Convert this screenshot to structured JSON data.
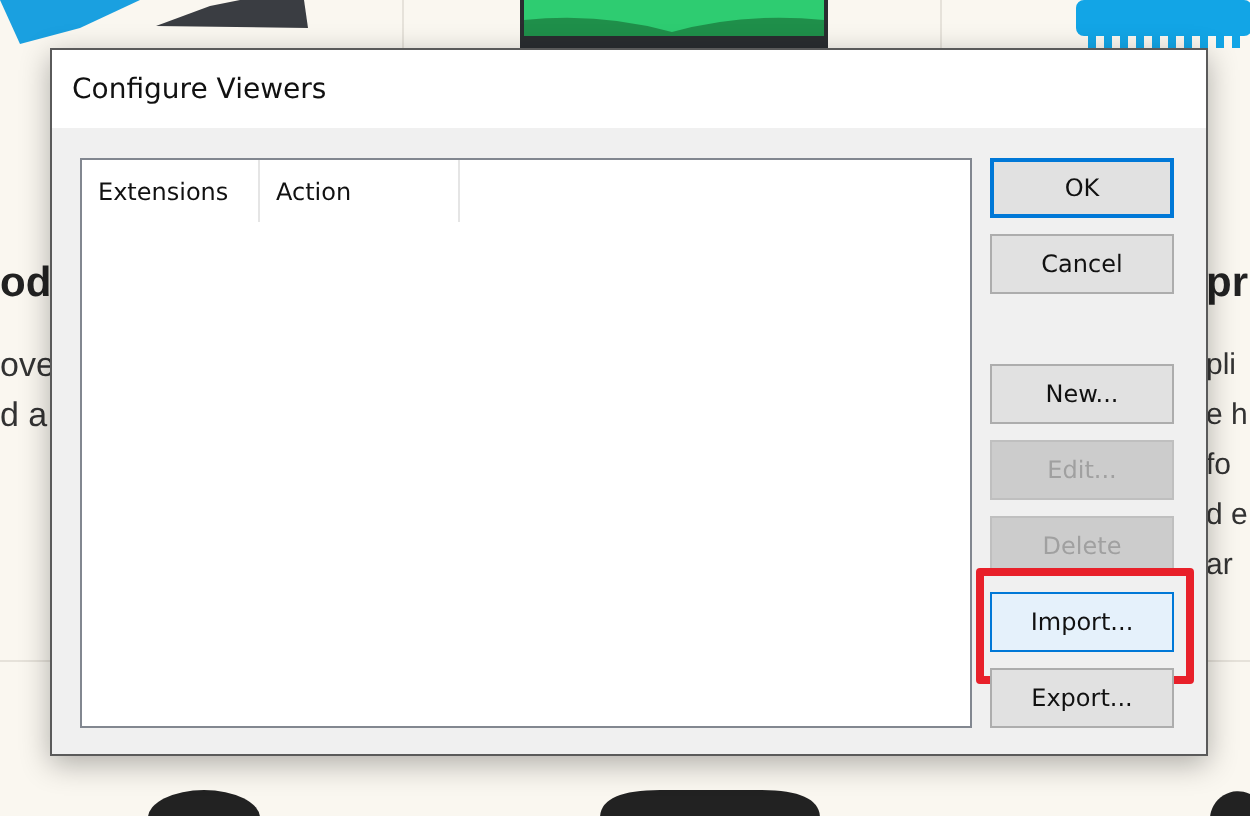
{
  "page": {
    "left_column": {
      "heading": "od",
      "lines": [
        "ove",
        "d a"
      ]
    },
    "right_column": {
      "heading": "pr",
      "lines": [
        "pli",
        "e h",
        "fo",
        "d e",
        "ar"
      ]
    }
  },
  "dialog": {
    "title": "Configure Viewers",
    "list": {
      "columns": [
        "Extensions",
        "Action"
      ]
    },
    "buttons": [
      {
        "label": "OK",
        "spaced": false,
        "default": true,
        "disabled": false,
        "highlighted": false,
        "annotated": false
      },
      {
        "label": "Cancel",
        "spaced": false,
        "default": false,
        "disabled": false,
        "highlighted": false,
        "annotated": false
      },
      {
        "label": "New...",
        "spaced": true,
        "default": false,
        "disabled": false,
        "highlighted": false,
        "annotated": false
      },
      {
        "label": "Edit...",
        "spaced": false,
        "default": false,
        "disabled": true,
        "highlighted": false,
        "annotated": false
      },
      {
        "label": "Delete",
        "spaced": false,
        "default": false,
        "disabled": true,
        "highlighted": false,
        "annotated": false
      },
      {
        "label": "Import...",
        "spaced": false,
        "default": false,
        "disabled": false,
        "highlighted": true,
        "annotated": true
      },
      {
        "label": "Export...",
        "spaced": false,
        "default": false,
        "disabled": false,
        "highlighted": false,
        "annotated": false
      }
    ]
  }
}
